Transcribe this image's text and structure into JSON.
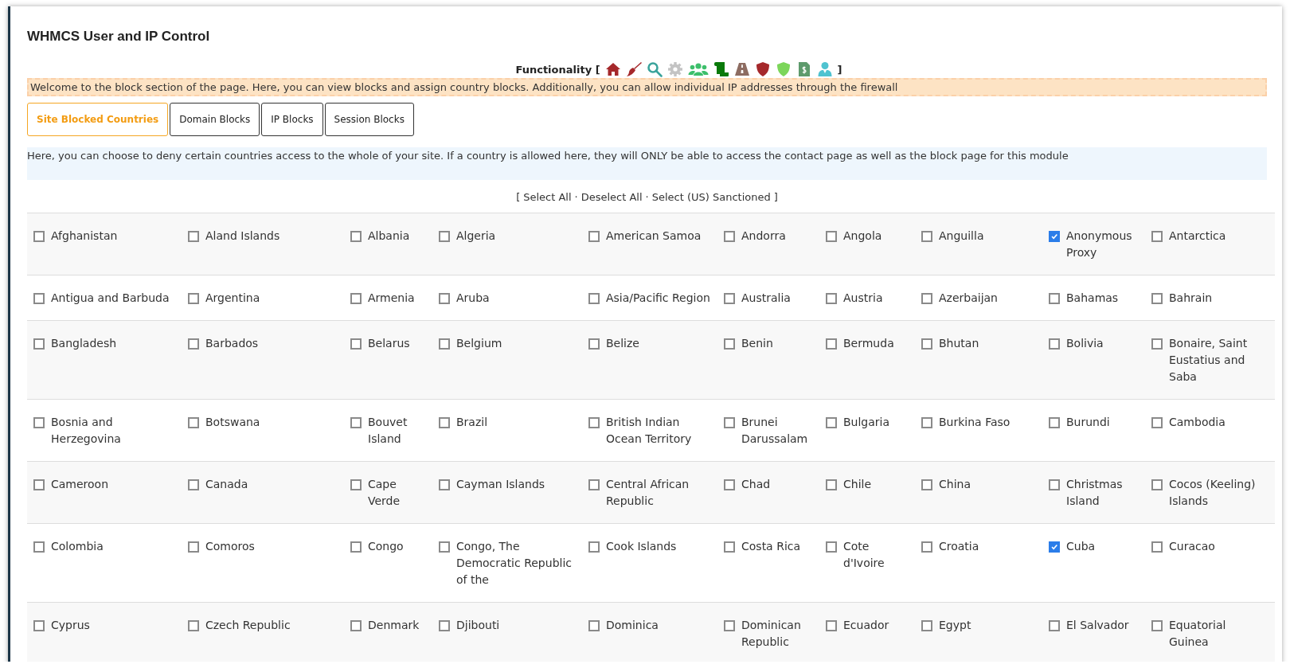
{
  "title": "WHMCS User and IP Control",
  "functionality": {
    "label": "Functionality [",
    "close": "]"
  },
  "welcome": "Welcome to the block section of the page. Here, you can view blocks and assign country blocks. Additionally, you can allow individual IP addresses through the firewall",
  "tabs": [
    {
      "label": "Site Blocked Countries",
      "selected": true
    },
    {
      "label": "Domain Blocks",
      "selected": false
    },
    {
      "label": "IP Blocks",
      "selected": false
    },
    {
      "label": "Session Blocks",
      "selected": false
    }
  ],
  "info": "Here, you can choose to deny certain countries access to the whole of your site. If a country is allowed here, they will ONLY be able to access the contact page as well as the block page for this module",
  "select_bar": {
    "open": "[",
    "links": [
      "Select All",
      "Deselect All",
      "Select (US) Sanctioned"
    ],
    "separators": [
      "·",
      "·"
    ],
    "close": "]"
  },
  "countries": [
    [
      {
        "name": "Afghanistan",
        "checked": false
      },
      {
        "name": "Aland Islands",
        "checked": false
      },
      {
        "name": "Albania",
        "checked": false
      },
      {
        "name": "Algeria",
        "checked": false
      },
      {
        "name": "American Samoa",
        "checked": false
      },
      {
        "name": "Andorra",
        "checked": false
      },
      {
        "name": "Angola",
        "checked": false
      },
      {
        "name": "Anguilla",
        "checked": false
      },
      {
        "name": "Anonymous Proxy",
        "checked": true
      },
      {
        "name": "Antarctica",
        "checked": false
      }
    ],
    [
      {
        "name": "Antigua and Barbuda",
        "checked": false
      },
      {
        "name": "Argentina",
        "checked": false
      },
      {
        "name": "Armenia",
        "checked": false
      },
      {
        "name": "Aruba",
        "checked": false
      },
      {
        "name": "Asia/Pacific Region",
        "checked": false
      },
      {
        "name": "Australia",
        "checked": false
      },
      {
        "name": "Austria",
        "checked": false
      },
      {
        "name": "Azerbaijan",
        "checked": false
      },
      {
        "name": "Bahamas",
        "checked": false
      },
      {
        "name": "Bahrain",
        "checked": false
      }
    ],
    [
      {
        "name": "Bangladesh",
        "checked": false
      },
      {
        "name": "Barbados",
        "checked": false
      },
      {
        "name": "Belarus",
        "checked": false
      },
      {
        "name": "Belgium",
        "checked": false
      },
      {
        "name": "Belize",
        "checked": false
      },
      {
        "name": "Benin",
        "checked": false
      },
      {
        "name": "Bermuda",
        "checked": false
      },
      {
        "name": "Bhutan",
        "checked": false
      },
      {
        "name": "Bolivia",
        "checked": false
      },
      {
        "name": "Bonaire, Saint Eustatius and Saba",
        "checked": false
      }
    ],
    [
      {
        "name": "Bosnia and Herzegovina",
        "checked": false
      },
      {
        "name": "Botswana",
        "checked": false
      },
      {
        "name": "Bouvet Island",
        "checked": false
      },
      {
        "name": "Brazil",
        "checked": false
      },
      {
        "name": "British Indian Ocean Territory",
        "checked": false
      },
      {
        "name": "Brunei Darussalam",
        "checked": false
      },
      {
        "name": "Bulgaria",
        "checked": false
      },
      {
        "name": "Burkina Faso",
        "checked": false
      },
      {
        "name": "Burundi",
        "checked": false
      },
      {
        "name": "Cambodia",
        "checked": false
      }
    ],
    [
      {
        "name": "Cameroon",
        "checked": false
      },
      {
        "name": "Canada",
        "checked": false
      },
      {
        "name": "Cape Verde",
        "checked": false
      },
      {
        "name": "Cayman Islands",
        "checked": false
      },
      {
        "name": "Central African Republic",
        "checked": false
      },
      {
        "name": "Chad",
        "checked": false
      },
      {
        "name": "Chile",
        "checked": false
      },
      {
        "name": "China",
        "checked": false
      },
      {
        "name": "Christmas Island",
        "checked": false
      },
      {
        "name": "Cocos (Keeling) Islands",
        "checked": false
      }
    ],
    [
      {
        "name": "Colombia",
        "checked": false
      },
      {
        "name": "Comoros",
        "checked": false
      },
      {
        "name": "Congo",
        "checked": false
      },
      {
        "name": "Congo, The Democratic Republic of the",
        "checked": false
      },
      {
        "name": "Cook Islands",
        "checked": false
      },
      {
        "name": "Costa Rica",
        "checked": false
      },
      {
        "name": "Cote d'Ivoire",
        "checked": false
      },
      {
        "name": "Croatia",
        "checked": false
      },
      {
        "name": "Cuba",
        "checked": true
      },
      {
        "name": "Curacao",
        "checked": false
      }
    ],
    [
      {
        "name": "Cyprus",
        "checked": false
      },
      {
        "name": "Czech Republic",
        "checked": false
      },
      {
        "name": "Denmark",
        "checked": false
      },
      {
        "name": "Djibouti",
        "checked": false
      },
      {
        "name": "Dominica",
        "checked": false
      },
      {
        "name": "Dominican Republic",
        "checked": false
      },
      {
        "name": "Ecuador",
        "checked": false
      },
      {
        "name": "Egypt",
        "checked": false
      },
      {
        "name": "El Salvador",
        "checked": false
      },
      {
        "name": "Equatorial Guinea",
        "checked": false
      }
    ]
  ]
}
